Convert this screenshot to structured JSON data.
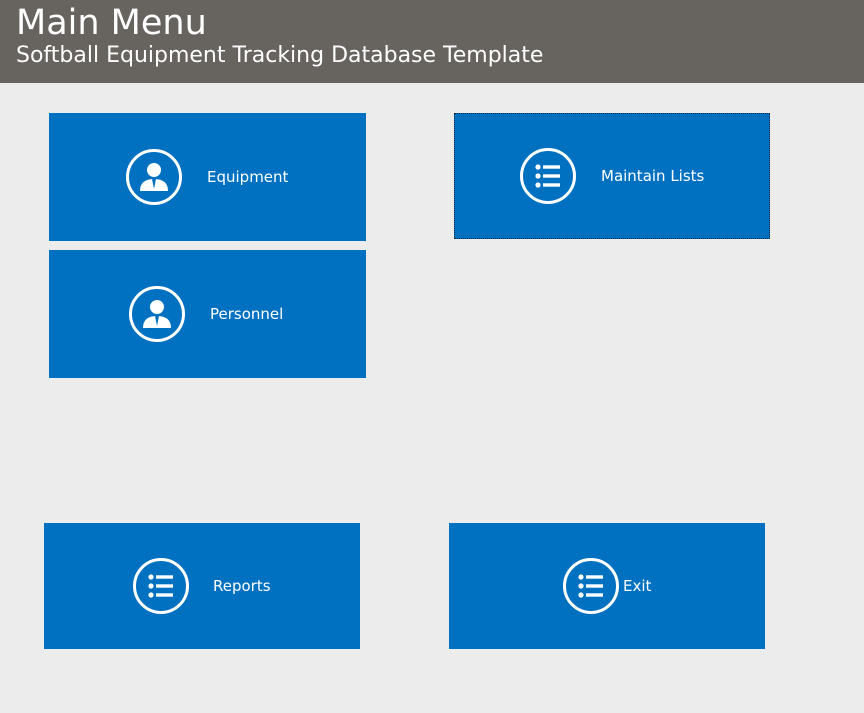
{
  "header": {
    "title": "Main Menu",
    "subtitle": "Softball Equipment Tracking Database Template"
  },
  "tiles": {
    "equipment": {
      "label": "Equipment",
      "icon": "person-icon"
    },
    "maintain_lists": {
      "label": "Maintain Lists",
      "icon": "list-icon"
    },
    "personnel": {
      "label": "Personnel",
      "icon": "person-icon"
    },
    "reports": {
      "label": "Reports",
      "icon": "list-icon"
    },
    "exit": {
      "label": "Exit",
      "icon": "list-icon"
    }
  },
  "colors": {
    "header_bg": "#67635e",
    "tile_bg": "#0070c0",
    "page_bg": "#ececec"
  }
}
